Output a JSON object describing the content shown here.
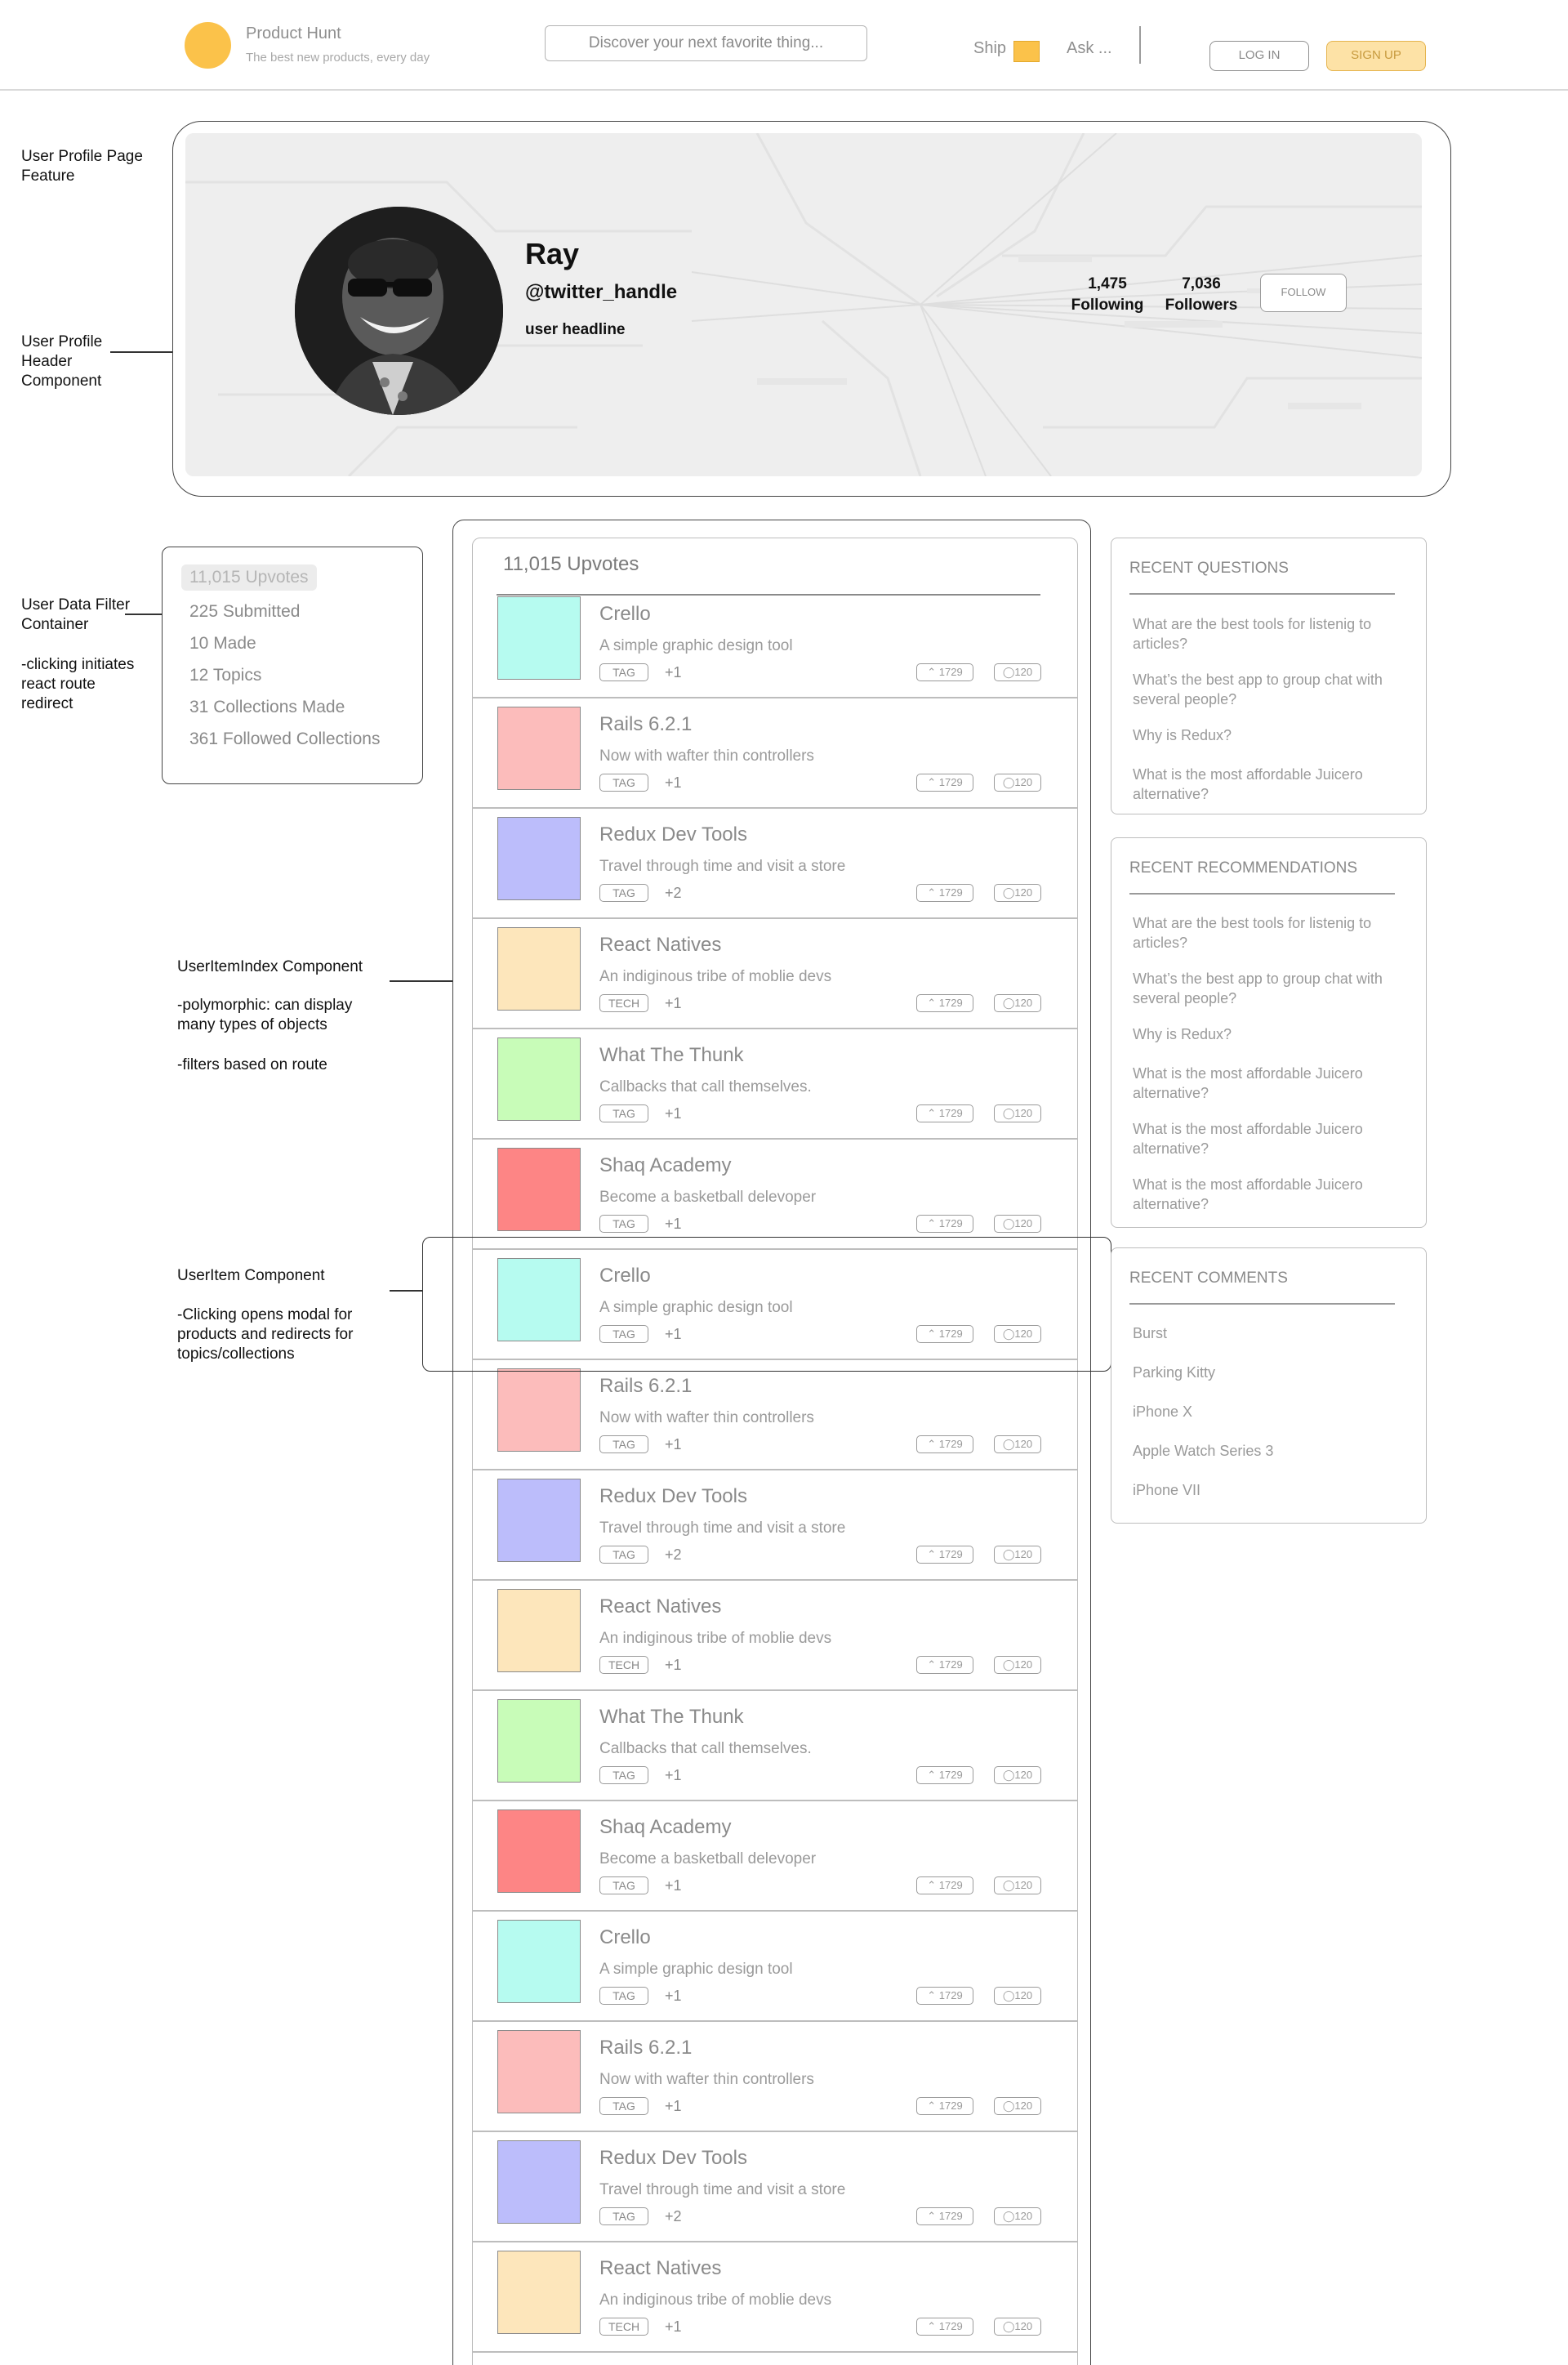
{
  "colors": {
    "accent": "#fbc24a",
    "signup_bg": "#fde2a6",
    "border_dark": "#444444",
    "border_light": "#bdbdbd",
    "muted_text": "#8a8a8a"
  },
  "nav": {
    "brand": "Product Hunt",
    "tagline": "The best new products, every day",
    "search_placeholder": "Discover your next favorite thing...",
    "ship": "Ship",
    "ask": "Ask ...",
    "login": "LOG IN",
    "signup": "SIGN UP"
  },
  "annotations": {
    "profile_page": "User Profile Page Feature",
    "profile_header": "User Profile Header Component",
    "filter_title": "User Data Filter Container",
    "filter_note": "-clicking initiates react route redirect",
    "index_title": "UserItemIndex Component",
    "index_note1": "-polymorphic: can display many types of objects",
    "index_note2": "-filters based on route",
    "item_title": "UserItem Component",
    "item_note": "-Clicking opens modal for products and redirects for topics/collections"
  },
  "profile": {
    "name": "Ray",
    "handle": "@twitter_handle",
    "headline": "user headline",
    "following_count": "1,475",
    "following_label": "Following",
    "followers_count": "7,036",
    "followers_label": "Followers",
    "follow_button": "FOLLOW",
    "avatar_icon": "user-portrait-photo"
  },
  "filters": [
    {
      "label": "11,015 Upvotes",
      "active": true
    },
    {
      "label": "225 Submitted",
      "active": false
    },
    {
      "label": "10 Made",
      "active": false
    },
    {
      "label": "12 Topics",
      "active": false
    },
    {
      "label": "31 Collections Made",
      "active": false
    },
    {
      "label": "361 Followed Collections",
      "active": false
    }
  ],
  "index": {
    "title": "11,015 Upvotes",
    "items": [
      {
        "title": "Crello",
        "desc": "A simple graphic design tool",
        "tag": "TAG",
        "extra": "+1",
        "votes": "1729",
        "comments": "120",
        "color": "#b6fbf0"
      },
      {
        "title": "Rails 6.2.1",
        "desc": "Now with wafter thin controllers",
        "tag": "TAG",
        "extra": "+1",
        "votes": "1729",
        "comments": "120",
        "color": "#fcbcbb"
      },
      {
        "title": "Redux Dev Tools",
        "desc": "Travel through time and visit a store",
        "tag": "TAG",
        "extra": "+2",
        "votes": "1729",
        "comments": "120",
        "color": "#bcbdfb"
      },
      {
        "title": "React Natives",
        "desc": "An indiginous tribe of moblie devs",
        "tag": "TECH",
        "extra": "+1",
        "votes": "1729",
        "comments": "120",
        "color": "#fde6bb"
      },
      {
        "title": "What The Thunk",
        "desc": "Callbacks that call themselves.",
        "tag": "TAG",
        "extra": "+1",
        "votes": "1729",
        "comments": "120",
        "color": "#c8fcb8"
      },
      {
        "title": "Shaq Academy",
        "desc": "Become a basketball delevoper",
        "tag": "TAG",
        "extra": "+1",
        "votes": "1729",
        "comments": "120",
        "color": "#fd8585"
      },
      {
        "title": "Crello",
        "desc": "A simple graphic design tool",
        "tag": "TAG",
        "extra": "+1",
        "votes": "1729",
        "comments": "120",
        "color": "#b6fbf0"
      },
      {
        "title": "Rails 6.2.1",
        "desc": "Now with wafter thin controllers",
        "tag": "TAG",
        "extra": "+1",
        "votes": "1729",
        "comments": "120",
        "color": "#fcbcbb"
      },
      {
        "title": "Redux Dev Tools",
        "desc": "Travel through time and visit a store",
        "tag": "TAG",
        "extra": "+2",
        "votes": "1729",
        "comments": "120",
        "color": "#bcbdfb"
      },
      {
        "title": "React Natives",
        "desc": "An indiginous tribe of moblie devs",
        "tag": "TECH",
        "extra": "+1",
        "votes": "1729",
        "comments": "120",
        "color": "#fde6bb"
      },
      {
        "title": "What The Thunk",
        "desc": "Callbacks that call themselves.",
        "tag": "TAG",
        "extra": "+1",
        "votes": "1729",
        "comments": "120",
        "color": "#c8fcb8"
      },
      {
        "title": "Shaq Academy",
        "desc": "Become a basketball delevoper",
        "tag": "TAG",
        "extra": "+1",
        "votes": "1729",
        "comments": "120",
        "color": "#fd8585"
      },
      {
        "title": "Crello",
        "desc": "A simple graphic design tool",
        "tag": "TAG",
        "extra": "+1",
        "votes": "1729",
        "comments": "120",
        "color": "#b6fbf0"
      },
      {
        "title": "Rails 6.2.1",
        "desc": "Now with wafter thin controllers",
        "tag": "TAG",
        "extra": "+1",
        "votes": "1729",
        "comments": "120",
        "color": "#fcbcbb"
      },
      {
        "title": "Redux Dev Tools",
        "desc": "Travel through time and visit a store",
        "tag": "TAG",
        "extra": "+2",
        "votes": "1729",
        "comments": "120",
        "color": "#bcbdfb"
      },
      {
        "title": "React Natives",
        "desc": "An indiginous tribe of moblie devs",
        "tag": "TECH",
        "extra": "+1",
        "votes": "1729",
        "comments": "120",
        "color": "#fde6bb"
      }
    ]
  },
  "sidebar": {
    "questions": {
      "title": "RECENT QUESTIONS",
      "items": [
        "What are the best tools for listenig to articles?",
        "What’s the best app to group chat with several people?",
        "Why is Redux?",
        "What is the most affordable Juicero alternative?"
      ]
    },
    "recommendations": {
      "title": "RECENT RECOMMENDATIONS",
      "items": [
        "What are the best tools for listenig to articles?",
        "What’s the best app to group chat with several people?",
        "Why is Redux?",
        "What is the most affordable Juicero alternative?",
        "What is the most affordable Juicero alternative?",
        "What is the most affordable Juicero alternative?"
      ]
    },
    "comments": {
      "title": "RECENT COMMENTS",
      "items": [
        "Burst",
        "Parking Kitty",
        "iPhone X",
        "Apple Watch Series 3",
        "iPhone VII"
      ]
    }
  }
}
